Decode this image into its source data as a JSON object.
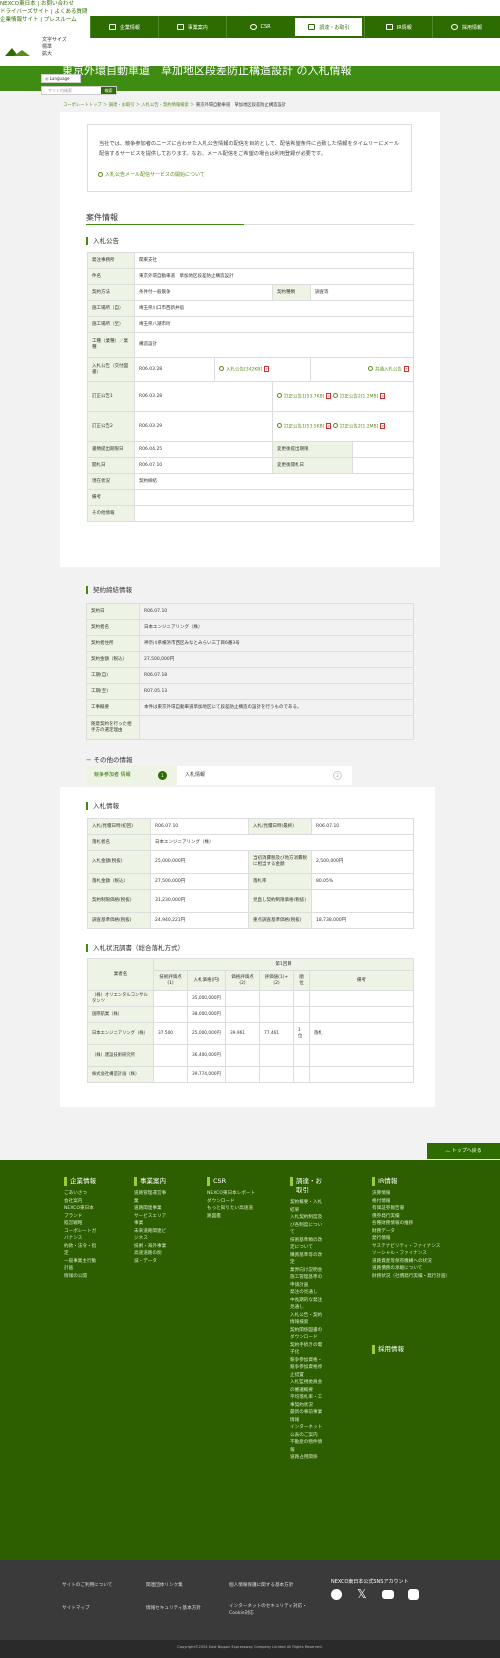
{
  "header": {
    "util_lines": [
      "NEXCO東日本 | お問い合わせ",
      "ドライバーズサイト | よくある質問",
      "企業情報サイト | プレスルーム"
    ],
    "nav": [
      "企業情報",
      "事業案内",
      "CSR",
      "調達・お取引",
      "IR情報",
      "採用情報"
    ],
    "font_size_label": "文字サイズ",
    "font_size_opts": [
      "標準",
      "拡大"
    ],
    "language": "Language",
    "search_placeholder": "サイト内検索",
    "search_button": "検索"
  },
  "hero": {
    "title": "東京外環自動車道　草加地区段差防止構造設計 の入札情報"
  },
  "breadcrumb": [
    "コーポレートトップ",
    "調達・お取引",
    "入札公告・契約情報検索",
    "東京外環自動車道　草加地区段差防止構造設計"
  ],
  "intro": {
    "text": "当社では、競争参加者のニーズに合わせた入札公告情報の配信を目的として、配信希望条件に合致した情報をタイムリーにメール配信するサービスを提供しております。なお、メール配信をご希望の場合は利用登録が必要です。",
    "link": "入札公告メール配信サービスの開始について"
  },
  "case_info": {
    "heading": "案件情報",
    "sub": "入札公告",
    "rows": {
      "office": [
        "発注事務所",
        "関東支社"
      ],
      "name": [
        "件名",
        "東京外環自動車道　草加地区段差防止構造設計"
      ],
      "method": [
        "契約方法",
        "条件付一般競争"
      ],
      "type": [
        "契約種類",
        "調査等"
      ],
      "place_from": [
        "施工場所（自）",
        "埼玉県川口市西新井宿"
      ],
      "place_to": [
        "施工場所（至）",
        "埼玉県八潮市垳"
      ],
      "work": [
        "工種（業種）／業種",
        "構造設計"
      ],
      "notice": [
        "入札公告（交付図書）",
        "R06.03.28",
        "入札公告[342KB]",
        "共通入札公告"
      ],
      "corr1": [
        "訂正公告1",
        "R06.03.28",
        "訂正公告1[53.7KB]",
        "訂正公告2[1.2MB]"
      ],
      "corr2": [
        "訂正公告2",
        "R06.03.29",
        "訂正公告1[53.5KB]",
        "訂正公告2[1.2MB]"
      ],
      "deadline": [
        "書類提出期限日",
        "R06.04.25"
      ],
      "change_deadline": [
        "変更後提出期限"
      ],
      "open_date": [
        "開札日",
        "R06.07.10"
      ],
      "change_open": [
        "変更後開札日"
      ],
      "status": [
        "現在状況",
        "契約締結"
      ],
      "remarks": [
        "備考",
        ""
      ],
      "other": [
        "その他情報",
        ""
      ]
    }
  },
  "contract": {
    "sub": "契約締結情報",
    "rows": [
      [
        "契約日",
        "R06.07.10"
      ],
      [
        "契約者名",
        "日本エンジニアリング（株）"
      ],
      [
        "契約者住所",
        "神奈川県横浜市西区みなとみらい三丁目6番3号"
      ],
      [
        "契約金額（税込）",
        "27,500,000円"
      ],
      [
        "工期(自)",
        "R06.07.18"
      ],
      [
        "工期(至)",
        "R07.05.13"
      ],
      [
        "工事概要",
        "本件は東京外環自動車道草加地区にて段差防止構造の設計を行うものである。"
      ],
      [
        "随意契約を行った相手方の選定理由",
        ""
      ]
    ]
  },
  "other_info": {
    "heading": "その他の情報",
    "tabs": [
      {
        "label": "競争参加者 情報",
        "num": "1"
      },
      {
        "label": "入札情報",
        "num": "2"
      }
    ]
  },
  "bid_info": {
    "sub": "入札情報",
    "rows": [
      [
        "入札/見積日時(初回)",
        "R06.07.10",
        "入札/見積日時(最終)",
        "R06.07.10"
      ],
      [
        "落札者名",
        "日本エンジニアリング（株）"
      ],
      [
        "入札金額(税抜)",
        "25,000,000円",
        "当初消費税及び地方消費税に相当する金額",
        "2,500,000円"
      ],
      [
        "落札金額（税込）",
        "27,500,000円",
        "落札率",
        "80.05%"
      ],
      [
        "契約制限価格(税抜)",
        "31,230,000円",
        "見直し契約制限価格(税抜)",
        ""
      ],
      [
        "調査基準価格(税抜)",
        "24,940,221円",
        "重点調査基準価格(税抜)",
        "18,738,000円"
      ]
    ]
  },
  "bid_results": {
    "sub": "入札状況調書（総合落札方式）",
    "round": "第1回目",
    "cols": [
      "業者名",
      "技術評価点(1)",
      "入札価格(円)",
      "価格評価点(2)",
      "評価値(1)+(2)",
      "順位",
      "備考"
    ],
    "rows": [
      [
        "（株）オリエンタルコンサルタンツ",
        "",
        "35,000,000円",
        "",
        "",
        "",
        ""
      ],
      [
        "国際航業（株）",
        "",
        "38,000,000円",
        "",
        "",
        "",
        ""
      ],
      [
        "日本エンジニアリング（株）",
        "37.500",
        "25,000,000円",
        "39.961",
        "77.461",
        "1位",
        "落札"
      ],
      [
        "（株）建設技術研究所",
        "",
        "36,400,000円",
        "",
        "",
        "",
        ""
      ],
      [
        "株式会社構造計画（株）",
        "",
        "39,774,000円",
        "",
        "",
        "",
        ""
      ]
    ]
  },
  "to_top": "トップへ戻る",
  "footer": {
    "cols": [
      {
        "h": "企業情報",
        "items": [
          "ごあいさつ",
          "会社案内",
          "NEXCO東日本ブランド",
          "経営戦略",
          "コーポレートガバナンス",
          "約款・法令・指定",
          "一般事業主行動計画",
          "情報の公開"
        ]
      },
      {
        "h": "事業案内",
        "items": [
          "道路管理運営事業",
          "道路関連事業",
          "サービスエリア事業",
          "未来道路関連ビジネス",
          "技術・海外事業",
          "高速道路の削減・データ"
        ]
      },
      {
        "h": "CSR",
        "items": [
          "NEXCO東日本レポートダウンロード",
          "もっと知りたい高速道路図鑑"
        ]
      },
      {
        "h": "調達・お取引",
        "items": [
          "契約概要・入札結果",
          "入札契約制度及び各制度について",
          "技術基準類の改定について",
          "購買基準等の改定",
          "業界向け説明会",
          "施工管理基準の申請計画",
          "発注の見通し",
          "中長期的な発注見通し",
          "入札公告・契約情報検索",
          "契約関係図書のダウンロード",
          "契約手続きの電子化",
          "競争参加資格・競争参加資格停止措置",
          "入札監視委員会の審議概要",
          "平均落札率・工事契約状況",
          "最新の事前事業情報",
          "インターネット公表のご案内",
          "不動産の物件情報",
          "道路占用関係"
        ]
      },
      {
        "h": "IR情報",
        "items": [
          "決算情報",
          "格付情報",
          "有価証券報告書",
          "債券発行実績",
          "各種財務情報の推移",
          "財務データ",
          "発行情報",
          "サステナビリティ・ファイナンス",
          "ソーシャル・ファイナンス",
          "道路資産等保有機構への状況",
          "道路債務の承継について",
          "財務状況（社債発行実績・発行計画）"
        ]
      },
      {
        "h": "採用情報",
        "items": []
      }
    ],
    "links": [
      "サイトのご利用について",
      "関連団体リンク集",
      "個人情報保護に関する基本方針",
      "サイトマップ",
      "情報セキュリティ基本方針",
      "インターネットのセキュリティ対応・Cookie対応"
    ],
    "sns_title": "NEXCO東日本公式SNSアカウント",
    "copyright": "Copyright©2024 East Nippon Expressway Company Limited All Rights Reserved."
  }
}
